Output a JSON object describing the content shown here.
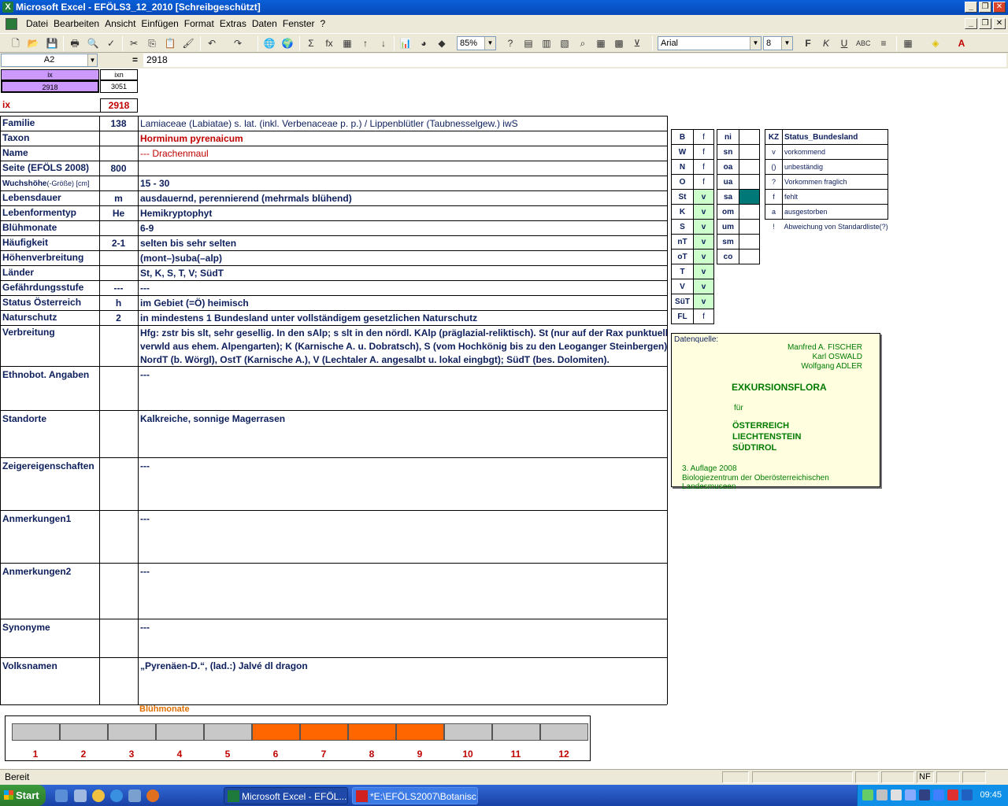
{
  "window": {
    "title": "Microsoft Excel - EFÖLS3_12_2010  [Schreibgeschützt]"
  },
  "menu": [
    "Datei",
    "Bearbeiten",
    "Ansicht",
    "Einfügen",
    "Format",
    "Extras",
    "Daten",
    "Fenster",
    "?"
  ],
  "toolbar": {
    "zoom": "85%",
    "font": "Arial",
    "font_size": "8"
  },
  "formula_bar": {
    "cell_ref": "A2",
    "eq": "=",
    "value": "2918"
  },
  "header_boxes": {
    "ix_label": "ix",
    "ixn_label": "ixn",
    "ix_value": "2918",
    "ixn_value": "3051"
  },
  "ix_row": {
    "label": "ix",
    "value": "2918"
  },
  "rows": [
    {
      "label": "Familie",
      "code": "138",
      "text": "Lamiaceae (Labiatae) s. lat. (inkl. Verbenaceae p. p.)  /  Lippenblütler (Taubnesselgew.) iwS"
    },
    {
      "label": "Taxon",
      "code": "",
      "text": "Horminum pyrenaicum"
    },
    {
      "label": "Name",
      "code": "",
      "text": "--- Drachenmaul"
    },
    {
      "label": "Seite (EFÖLS 2008)",
      "code": "800",
      "text": ""
    },
    {
      "label": "Wuchshöhe",
      "label_extra": "(-Größe) [cm]",
      "code": "",
      "text": " 15 - 30"
    },
    {
      "label": "Lebensdauer",
      "code": "m",
      "text": "ausdauernd, perennierend (mehrmals blühend)"
    },
    {
      "label": "Lebenformentyp",
      "code": "He",
      "text": "Hemikryptophyt"
    },
    {
      "label": "Blühmonate",
      "code": "",
      "text": " 6-9"
    },
    {
      "label": "Häufigkeit",
      "code": "2-1",
      "text": "selten bis sehr selten"
    },
    {
      "label": "Höhenverbreitung",
      "code": "",
      "text": "(mont–)suba(–alp)"
    },
    {
      "label": "Länder",
      "code": "",
      "text": "St,  K, S, T, V; SüdT"
    },
    {
      "label": "Gefährdungsstufe",
      "code": "---",
      "text": " ---"
    },
    {
      "label": "Status Österreich",
      "code": "h",
      "text": "im Gebiet (=Ö) heimisch"
    },
    {
      "label": "Naturschutz",
      "code": "2",
      "text": "in mindestens 1 Bundesland unter vollständigem gesetzlichen Naturschutz"
    }
  ],
  "verbreitung": {
    "label": "Verbreitung",
    "lines": [
      "Hfg: zstr bis slt, sehr gesellig. In den sAlp; s slt in den nördl. KAlp (präglazial-reliktisch). St (nur auf der Rax punktuell;",
      "verwld aus ehem. Alpengarten); K (Karnische A. u. Dobratsch), S (vom Hochkönig bis zu den Leoganger Steinbergen),",
      "NordT (b. Wörgl), OstT (Karnische A.), V (Lechtaler A. angesalbt u. lokal eingbgt); SüdT (bes. Dolomiten)."
    ]
  },
  "big_rows": [
    {
      "label": "Ethnobot. Angaben",
      "text": "---"
    },
    {
      "label": "Standorte",
      "text": "Kalkreiche, sonnige Magerrasen"
    },
    {
      "label": "Zeigereigenschaften",
      "text": "---"
    },
    {
      "label": "Anmerkungen1",
      "text": "---"
    },
    {
      "label": "Anmerkungen2",
      "text": "---"
    },
    {
      "label": "Synonyme",
      "text": "---"
    },
    {
      "label": "Volksnamen",
      "text": "„Pyrenäen-D.“, (lad.:) Jalvé dl dragon"
    }
  ],
  "land_table": [
    {
      "k": "B",
      "v": "f"
    },
    {
      "k": "W",
      "v": "f"
    },
    {
      "k": "N",
      "v": "f"
    },
    {
      "k": "O",
      "v": "f"
    },
    {
      "k": "St",
      "v": "v"
    },
    {
      "k": "K",
      "v": "v"
    },
    {
      "k": "S",
      "v": "v"
    },
    {
      "k": "nT",
      "v": "v"
    },
    {
      "k": "oT",
      "v": "v"
    },
    {
      "k": "T",
      "v": "v"
    },
    {
      "k": "V",
      "v": "v"
    },
    {
      "k": "SüT",
      "v": "v"
    },
    {
      "k": "FL",
      "v": "f"
    }
  ],
  "region_table": [
    "ni",
    "sn",
    "oa",
    "ua",
    "sa",
    "om",
    "um",
    "sm",
    "co"
  ],
  "status_legend": {
    "header_kz": "KZ",
    "header": "Status_Bundesland",
    "items": [
      {
        "kz": "v",
        "text": "vorkommend"
      },
      {
        "kz": "()",
        "text": "unbeständig"
      },
      {
        "kz": "?",
        "text": "Vorkommen fraglich"
      },
      {
        "kz": "f",
        "text": "fehlt"
      },
      {
        "kz": "a",
        "text": "ausgestorben"
      },
      {
        "kz": "!",
        "text": "Abweichung von Standardliste(?)"
      }
    ]
  },
  "datasource": {
    "heading": "Datenquelle:",
    "authors": [
      "Manfred A. FISCHER",
      "Karl OSWALD",
      "Wolfgang ADLER"
    ],
    "title": "EXKURSIONSFLORA",
    "fuer": "für",
    "countries": [
      "ÖSTERREICH",
      "LIECHTENSTEIN",
      "SÜDTIROL"
    ],
    "edition": "3. Auflage 2008",
    "publisher": "Biologiezentrum der Oberösterreichischen Landesmuseen"
  },
  "bloom": {
    "title": "Blühmonate",
    "months": [
      "1",
      "2",
      "3",
      "4",
      "5",
      "6",
      "7",
      "8",
      "9",
      "10",
      "11",
      "12"
    ],
    "active": [
      0,
      0,
      0,
      0,
      0,
      1,
      1,
      1,
      1,
      0,
      0,
      0
    ],
    "active_color": "#ff6600",
    "inactive_color": "#c8c8c8"
  },
  "statusbar": {
    "text": "Bereit",
    "nf": "NF"
  },
  "taskbar": {
    "start": "Start",
    "tasks": [
      "Microsoft Excel - EFÖL...",
      "*E:\\EFÖLS2007\\Botanisc..."
    ],
    "clock": "09:45"
  }
}
